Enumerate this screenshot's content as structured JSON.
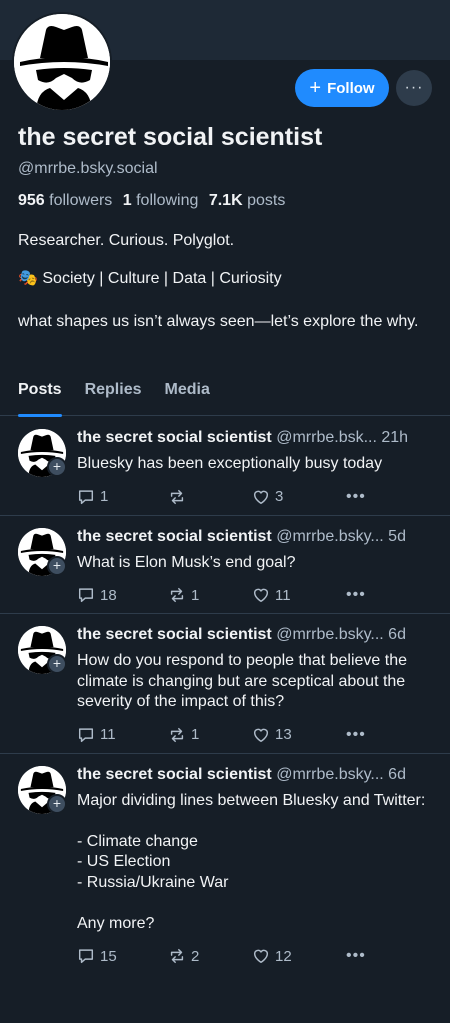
{
  "profile": {
    "display_name": "the secret social scientist",
    "handle": "@mrrbe.bsky.social",
    "followers_count": "956",
    "followers_label": "followers",
    "following_count": "1",
    "following_label": "following",
    "posts_count": "7.1K",
    "posts_label": "posts",
    "bio_line1": "Researcher. Curious. Polyglot.",
    "bio_line2": "🎭 Society | Culture | Data | Curiosity",
    "bio_line3": "what shapes us isn’t always seen—let’s explore the why.",
    "follow_label": "Follow",
    "more_label": "···"
  },
  "tabs": [
    {
      "label": "Posts",
      "active": true
    },
    {
      "label": "Replies",
      "active": false
    },
    {
      "label": "Media",
      "active": false
    }
  ],
  "posts": [
    {
      "author": "the secret social scientist",
      "handle_time": "@mrrbe.bsk... 21h",
      "text": "Bluesky has been exceptionally busy today",
      "replies": "1",
      "reposts": "",
      "likes": "3"
    },
    {
      "author": "the secret social scientist",
      "handle_time": "@mrrbe.bsky... 5d",
      "text": "What is Elon Musk’s end goal?",
      "replies": "18",
      "reposts": "1",
      "likes": "11"
    },
    {
      "author": "the secret social scientist",
      "handle_time": "@mrrbe.bsky... 6d",
      "text": "How do you respond to people that believe the climate is changing but are sceptical about the severity of the impact of this?",
      "replies": "11",
      "reposts": "1",
      "likes": "13"
    },
    {
      "author": "the secret social scientist",
      "handle_time": "@mrrbe.bsky... 6d",
      "text": "Major dividing lines between Bluesky and Twitter:\n\n- Climate change\n- US Election\n- Russia/Ukraine War\n\nAny more?",
      "replies": "15",
      "reposts": "2",
      "likes": "12"
    }
  ],
  "colors": {
    "background": "#161e27",
    "accent": "#208bfe",
    "muted_text": "#aebbc9"
  }
}
